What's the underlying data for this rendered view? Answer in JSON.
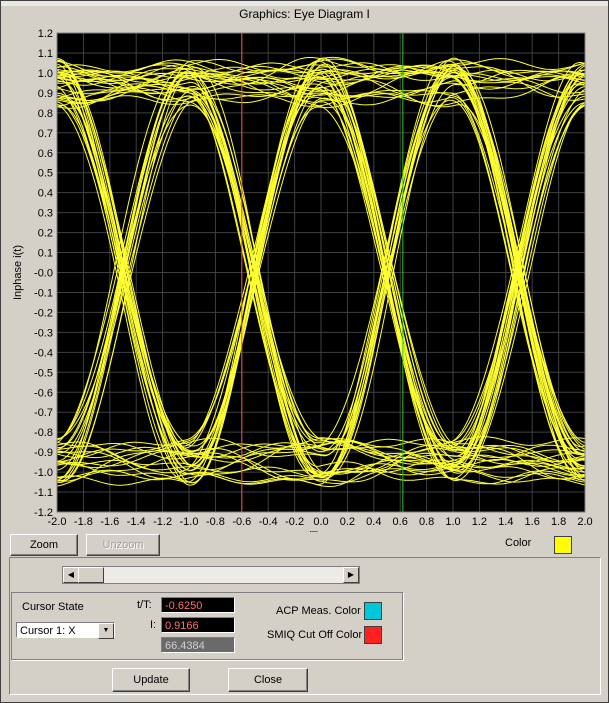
{
  "window": {
    "title": "Graphics: Eye Diagram I"
  },
  "chart_data": {
    "type": "line",
    "xlabel": "t/Tsym",
    "ylabel": "Inphase i(t)",
    "xlim": [
      -2.0,
      2.0
    ],
    "ylim": [
      -1.2,
      1.2
    ],
    "x_ticks": [
      "-2.0",
      "-1.8",
      "-1.6",
      "-1.4",
      "-1.2",
      "-1.0",
      "-0.8",
      "-0.6",
      "-0.4",
      "-0.2",
      "0.0",
      "0.2",
      "0.4",
      "0.6",
      "0.8",
      "1.0",
      "1.2",
      "1.4",
      "1.6",
      "1.8",
      "2.0"
    ],
    "y_ticks": [
      "1.2",
      "1.1",
      "1.0",
      "0.9",
      "0.8",
      "0.7",
      "0.6",
      "0.5",
      "0.4",
      "0.3",
      "0.2",
      "0.1",
      "-0.0",
      "-0.1",
      "-0.2",
      "-0.3",
      "-0.4",
      "-0.5",
      "-0.6",
      "-0.7",
      "-0.8",
      "-0.9",
      "-1.0",
      "-1.1",
      "-1.2"
    ],
    "eye_crossings_x": [
      -1.55,
      -0.55,
      0.45,
      1.45
    ],
    "trace_color": "#ffff33",
    "background": "#000000",
    "grid": true,
    "cursor_lines": [
      {
        "x": -0.6,
        "color": "#ff4444"
      },
      {
        "x": 0.62,
        "color": "#22cc22"
      }
    ]
  },
  "toolbar": {
    "zoom_label": "Zoom",
    "unzoom_label": "Unzoom",
    "color_label": "Color",
    "trace_color": "#ffff00"
  },
  "cursor": {
    "state_label": "Cursor State",
    "selected": "Cursor 1: X",
    "t_label": "t/T:",
    "t_value": "-0.6250",
    "i_label": "I:",
    "i_value": "0.9166",
    "extra_value": "66.4384"
  },
  "colors": {
    "acp_label": "ACP Meas. Color",
    "acp_color": "#00c8d8",
    "smiq_label": "SMIQ Cut Off Color",
    "smiq_color": "#ff2020"
  },
  "actions": {
    "update_label": "Update",
    "close_label": "Close"
  }
}
